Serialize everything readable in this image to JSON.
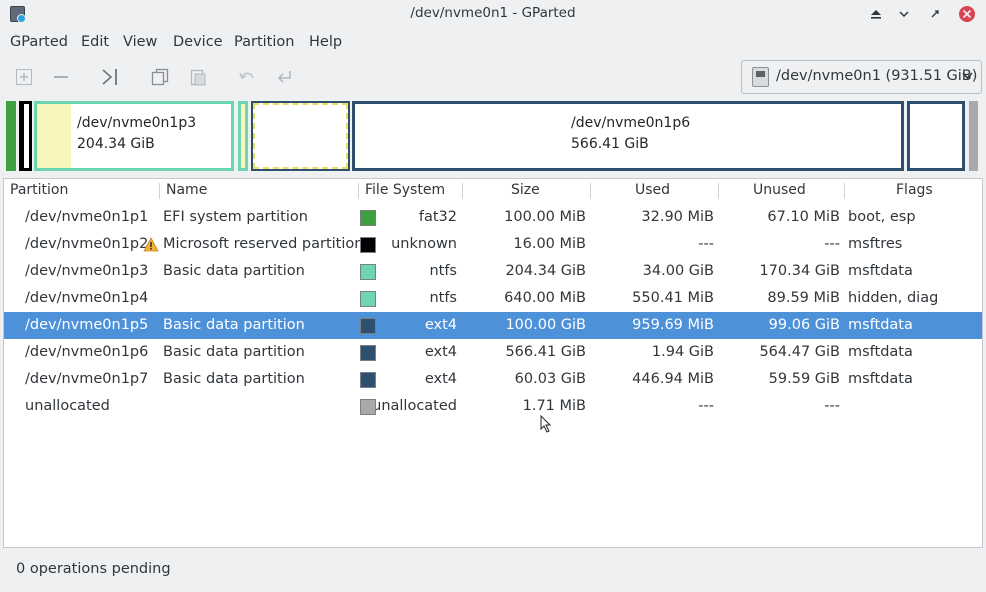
{
  "window": {
    "title": "/dev/nvme0n1 - GParted"
  },
  "menubar": {
    "items": [
      "GParted",
      "Edit",
      "View",
      "Device",
      "Partition",
      "Help"
    ]
  },
  "toolbar": {
    "buttons": [
      "new-icon",
      "delete-icon",
      "resize-move-icon",
      "copy-icon",
      "paste-icon",
      "undo-icon",
      "apply-icon"
    ],
    "device_label": "/dev/nvme0n1 (931.51 GiB)"
  },
  "partition_map": [
    {
      "name": "/dev/nvme0n1p3",
      "size": "204.34 GiB"
    },
    {
      "name": "/dev/nvme0n1p6",
      "size": "566.41 GiB"
    }
  ],
  "table": {
    "columns": [
      "Partition",
      "Name",
      "File System",
      "Size",
      "Used",
      "Unused",
      "Flags"
    ],
    "rows": [
      {
        "partition": "/dev/nvme0n1p1",
        "name": "EFI system partition",
        "fs": "fat32",
        "fs_color": "#3ea03e",
        "size": "100.00 MiB",
        "used": "32.90 MiB",
        "unused": "67.10 MiB",
        "flags": "boot, esp"
      },
      {
        "partition": "/dev/nvme0n1p2",
        "name": "Microsoft reserved partition",
        "fs": "unknown",
        "fs_color": "#000000",
        "size": "16.00 MiB",
        "used": "---",
        "unused": "---",
        "flags": "msftres",
        "warning": true
      },
      {
        "partition": "/dev/nvme0n1p3",
        "name": "Basic data partition",
        "fs": "ntfs",
        "fs_color": "#6fd5b0",
        "size": "204.34 GiB",
        "used": "34.00 GiB",
        "unused": "170.34 GiB",
        "flags": "msftdata"
      },
      {
        "partition": "/dev/nvme0n1p4",
        "name": "",
        "fs": "ntfs",
        "fs_color": "#6fd5b0",
        "size": "640.00 MiB",
        "used": "550.41 MiB",
        "unused": "89.59 MiB",
        "flags": "hidden, diag"
      },
      {
        "partition": "/dev/nvme0n1p5",
        "name": "Basic data partition",
        "fs": "ext4",
        "fs_color": "#2f4f6f",
        "size": "100.00 GiB",
        "used": "959.69 MiB",
        "unused": "99.06 GiB",
        "flags": "msftdata",
        "selected": true
      },
      {
        "partition": "/dev/nvme0n1p6",
        "name": "Basic data partition",
        "fs": "ext4",
        "fs_color": "#2f4f6f",
        "size": "566.41 GiB",
        "used": "1.94 GiB",
        "unused": "564.47 GiB",
        "flags": "msftdata"
      },
      {
        "partition": "/dev/nvme0n1p7",
        "name": "Basic data partition",
        "fs": "ext4",
        "fs_color": "#2f4f6f",
        "size": "60.03 GiB",
        "used": "446.94 MiB",
        "unused": "59.59 GiB",
        "flags": "msftdata"
      },
      {
        "partition": "unallocated",
        "name": "",
        "fs": "unallocated",
        "fs_color": "#a9a9a9",
        "size": "1.71 MiB",
        "used": "---",
        "unused": "---",
        "flags": ""
      }
    ]
  },
  "statusbar": {
    "text": "0 operations pending"
  }
}
